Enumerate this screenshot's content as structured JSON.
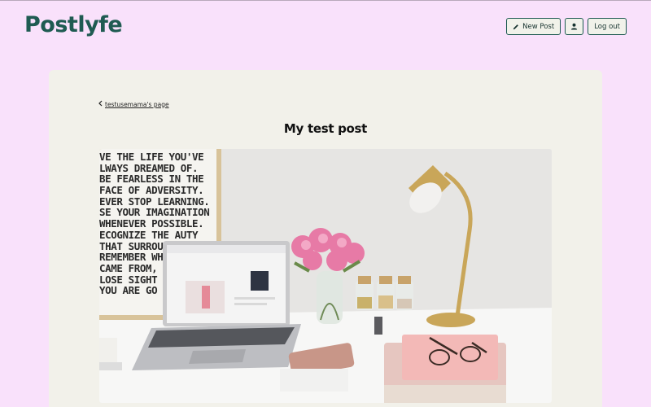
{
  "header": {
    "logo": "Postlyfe",
    "new_post_label": "New Post",
    "logout_label": "Log out"
  },
  "post": {
    "back_label": "testusemama's page",
    "title": "My test post"
  },
  "poster_lines": [
    "VE THE LIFE YOU'VE",
    "LWAYS  DREAMED OF.",
    "BE FEARLESS IN THE",
    "FACE OF ADVERSITY.",
    "EVER STOP LEARNING.",
    "SE YOUR IMAGINATION",
    "WHENEVER POSSIBLE.",
    "ECOGNIZE THE     AUTY",
    "THAT SURROUN",
    "REMEMBER WH",
    "CAME FROM, BU",
    "LOSE SIGHT OF",
    "YOU ARE GO"
  ],
  "colors": {
    "background": "#f9e1fb",
    "brand": "#1f5b52",
    "card": "#f2f1ea"
  }
}
